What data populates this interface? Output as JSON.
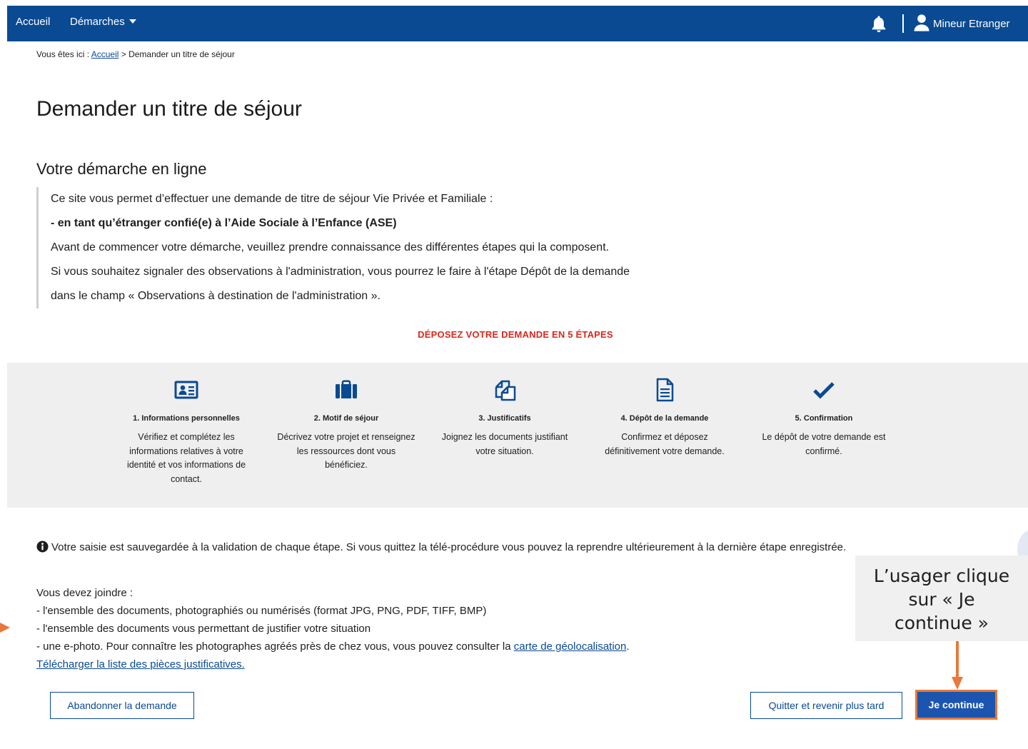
{
  "nav": {
    "home": "Accueil",
    "demarches": "Démarches",
    "user_name": "Mineur Etranger"
  },
  "breadcrumb": {
    "prefix": "Vous êtes ici :",
    "home": "Accueil",
    "current": "> Demander un titre de séjour"
  },
  "page_title": "Demander un titre de séjour",
  "section_title": "Votre démarche en ligne",
  "intro": {
    "line1": "Ce site vous permet d’effectuer une demande de titre de séjour Vie Privée et Familiale :",
    "line2": "- en tant qu’étranger confié(e) à l’Aide Sociale à l’Enfance (ASE)",
    "line3": "Avant de commencer votre démarche, veuillez prendre connaissance des différentes étapes qui la composent.",
    "line4": "Si vous souhaitez signaler des observations à l'administration, vous pourrez le faire à l'étape Dépôt de la demande",
    "line5": "dans le champ « Observations à destination de l'administration »."
  },
  "steps_heading": "DÉPOSEZ VOTRE DEMANDE EN 5 ÉTAPES",
  "steps": [
    {
      "icon": "id-card-icon",
      "title": "1. Informations personnelles",
      "desc": "Vérifiez et complétez les informations relatives à votre identité et vos informations de contact."
    },
    {
      "icon": "suitcase-icon",
      "title": "2. Motif de séjour",
      "desc": "Décrivez votre projet et renseignez les ressources dont vous bénéficiez."
    },
    {
      "icon": "copy-documents-icon",
      "title": "3. Justificatifs",
      "desc": "Joignez les documents justifiant votre situation."
    },
    {
      "icon": "document-icon",
      "title": "4. Dépôt de la demande",
      "desc": "Confirmez et déposez définitivement votre demande."
    },
    {
      "icon": "checkmark-icon",
      "title": "5. Confirmation",
      "desc": "Le dépôt de votre demande est confirmé."
    }
  ],
  "info_text": "Votre saisie est sauvegardée à la validation de chaque étape. Si vous quittez la télé-procédure vous pouvez la reprendre ultérieurement à la dernière étape enregistrée.",
  "docs": {
    "heading": "Vous devez joindre :",
    "item1": "- l'ensemble des documents, photographiés ou numérisés (format JPG, PNG, PDF, TIFF, BMP)",
    "item2": "- l'ensemble des documents vous permettant de justifier votre situation",
    "item3_prefix": "- une e-photo. Pour connaître les photographes agréés près de chez vous, vous pouvez consulter la",
    "item3_link": "carte de géolocalisation",
    "item3_suffix": ".",
    "download_link": "Télécharger la liste des pièces justificatives."
  },
  "buttons": {
    "abandon": "Abandonner la demande",
    "quit": "Quitter et revenir plus tard",
    "continue": "Je continue"
  },
  "annotation": {
    "line1": "L’usager clique",
    "line2": "sur « Je",
    "line3": "continue »"
  },
  "colors": {
    "nav_bg": "#0a4a92",
    "accent_red": "#d9291c",
    "annotation_orange": "#e8793a",
    "panel_bg": "#efefef"
  }
}
